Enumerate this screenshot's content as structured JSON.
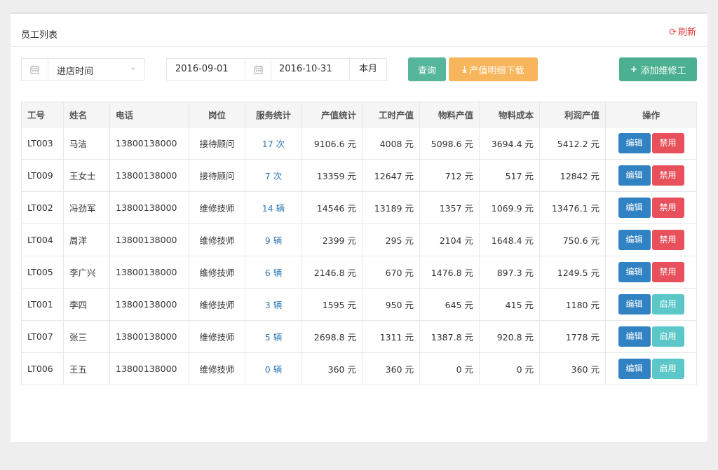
{
  "panel": {
    "title": "员工列表",
    "refresh": "刷新"
  },
  "filters": {
    "time_type": "进店时间",
    "start_date": "2016-09-01",
    "end_date": "2016-10-31",
    "this_month": "本月"
  },
  "buttons": {
    "query": "查询",
    "download": "产值明细下载",
    "add": "添加维修工"
  },
  "icons": {
    "calendar": "calendar-icon",
    "refresh": "refresh-icon",
    "download": "download-icon",
    "plus": "plus-icon"
  },
  "colors": {
    "query": "#55b69b",
    "download": "#f7b55c",
    "add": "#4bb08f",
    "edit": "#3182c3",
    "disable": "#e8505b",
    "enable": "#5bc7c9",
    "refresh": "#e4393c"
  },
  "table": {
    "headers": [
      "工号",
      "姓名",
      "电话",
      "岗位",
      "服务统计",
      "产值统计",
      "工时产值",
      "物料产值",
      "物料成本",
      "利润产值",
      "操作"
    ],
    "edit_label": "编辑",
    "rows": [
      {
        "id": "LT003",
        "name": "马洁",
        "phone": "13800138000",
        "role": "接待顾问",
        "service": "17 次",
        "output": "9106.6 元",
        "labor": "4008 元",
        "material": "5098.6 元",
        "cost": "3694.4 元",
        "profit": "5412.2 元",
        "toggle": "禁用",
        "state": "disable"
      },
      {
        "id": "LT009",
        "name": "王女士",
        "phone": "13800138000",
        "role": "接待顾问",
        "service": "7 次",
        "output": "13359 元",
        "labor": "12647 元",
        "material": "712 元",
        "cost": "517 元",
        "profit": "12842 元",
        "toggle": "禁用",
        "state": "disable"
      },
      {
        "id": "LT002",
        "name": "冯劲军",
        "phone": "13800138000",
        "role": "维修技师",
        "service": "14 辆",
        "output": "14546 元",
        "labor": "13189 元",
        "material": "1357 元",
        "cost": "1069.9 元",
        "profit": "13476.1 元",
        "toggle": "禁用",
        "state": "disable"
      },
      {
        "id": "LT004",
        "name": "周洋",
        "phone": "13800138000",
        "role": "维修技师",
        "service": "9 辆",
        "output": "2399 元",
        "labor": "295 元",
        "material": "2104 元",
        "cost": "1648.4 元",
        "profit": "750.6 元",
        "toggle": "禁用",
        "state": "disable"
      },
      {
        "id": "LT005",
        "name": "李广兴",
        "phone": "13800138000",
        "role": "维修技师",
        "service": "6 辆",
        "output": "2146.8 元",
        "labor": "670 元",
        "material": "1476.8 元",
        "cost": "897.3 元",
        "profit": "1249.5 元",
        "toggle": "禁用",
        "state": "disable"
      },
      {
        "id": "LT001",
        "name": "李四",
        "phone": "13800138000",
        "role": "维修技师",
        "service": "3 辆",
        "output": "1595 元",
        "labor": "950 元",
        "material": "645 元",
        "cost": "415 元",
        "profit": "1180 元",
        "toggle": "启用",
        "state": "enable"
      },
      {
        "id": "LT007",
        "name": "张三",
        "phone": "13800138000",
        "role": "维修技师",
        "service": "5 辆",
        "output": "2698.8 元",
        "labor": "1311 元",
        "material": "1387.8 元",
        "cost": "920.8 元",
        "profit": "1778 元",
        "toggle": "启用",
        "state": "enable"
      },
      {
        "id": "LT006",
        "name": "王五",
        "phone": "13800138000",
        "role": "维修技师",
        "service": "0 辆",
        "output": "360 元",
        "labor": "360 元",
        "material": "0 元",
        "cost": "0 元",
        "profit": "360 元",
        "toggle": "启用",
        "state": "enable"
      }
    ]
  }
}
